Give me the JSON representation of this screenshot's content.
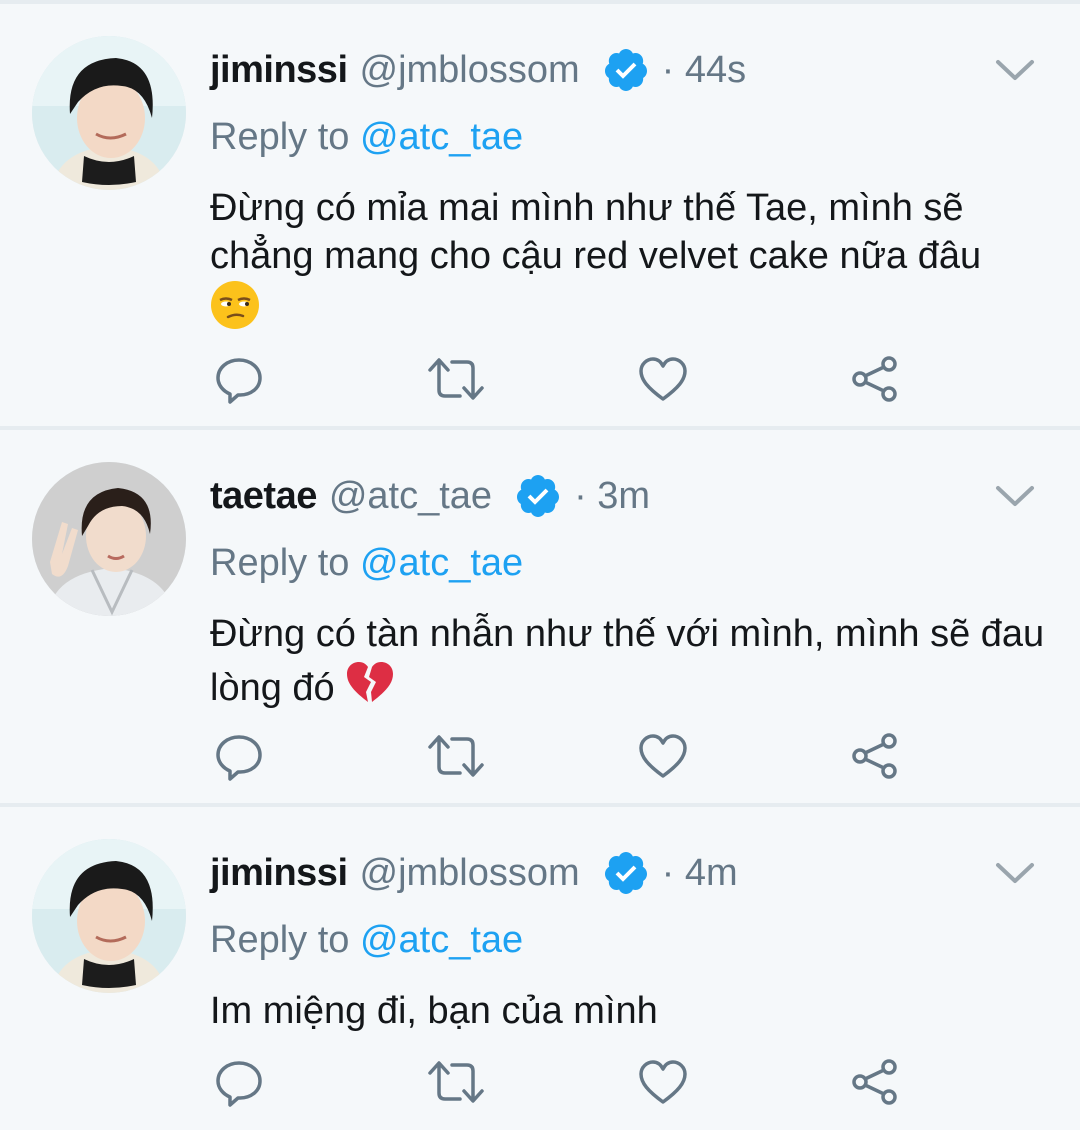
{
  "tweets": [
    {
      "name": "jiminssi",
      "handle": "@jmblossom",
      "time": "· 44s",
      "reply_prefix": "Reply to",
      "reply_mention": "@atc_tae",
      "text": "Đừng có mỉa mai mình như thế Tae, mình sẽ chẳng mang cho cậu red velvet cake nữa đâu",
      "emoji": "unamused-face-icon"
    },
    {
      "name": "taetae",
      "handle": "@atc_tae",
      "time": "· 3m",
      "reply_prefix": "Reply to",
      "reply_mention": "@atc_tae",
      "text": "Đừng có tàn nhẫn như thế với mình, mình sẽ đau lòng đó",
      "emoji": "broken-heart-icon"
    },
    {
      "name": "jiminssi",
      "handle": "@jmblossom",
      "time": "· 4m",
      "reply_prefix": "Reply to",
      "reply_mention": "@atc_tae",
      "text": "Im miệng đi, bạn của mình"
    }
  ],
  "icons": {
    "reply": "speech-bubble-icon",
    "retweet": "retweet-icon",
    "like": "heart-icon",
    "share": "share-icon",
    "verified": "verified-badge-icon",
    "menu": "chevron-down-icon"
  },
  "colors": {
    "background": "#f5f8fa",
    "divider": "#e6ecf0",
    "text": "#14171a",
    "secondary": "#657786",
    "accent": "#1da1f2"
  }
}
